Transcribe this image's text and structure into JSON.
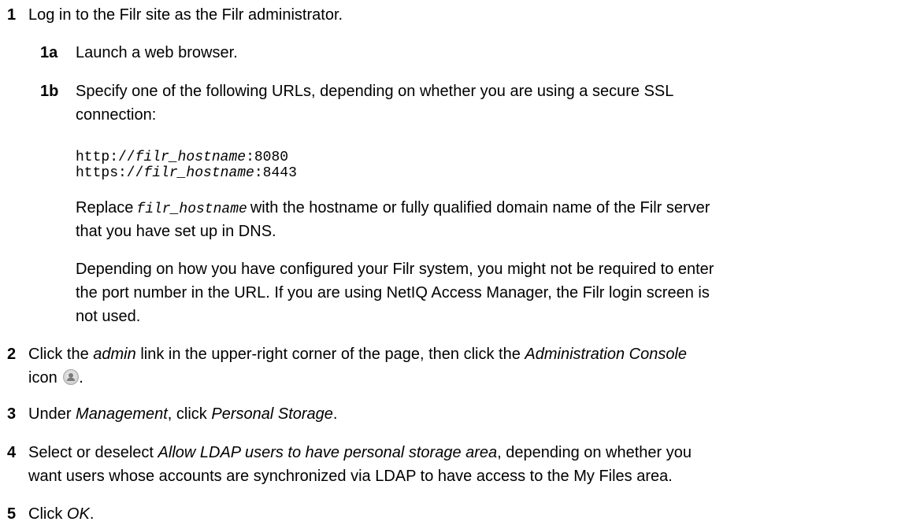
{
  "steps": [
    {
      "num": "1",
      "text": "Log in to the Filr site as the Filr administrator.",
      "substeps": [
        {
          "num": "1a",
          "text": "Launch a web browser."
        },
        {
          "num": "1b",
          "text_line1": "Specify one of the following URLs, depending on whether you are using a secure SSL",
          "text_line2": "connection:",
          "urls": [
            {
              "prefix": "http://",
              "var": "filr_hostname",
              "suffix": ":8080"
            },
            {
              "prefix": "https://",
              "var": "filr_hostname",
              "suffix": ":8443"
            }
          ],
          "replace": {
            "pre": "Replace",
            "var": "filr_hostname",
            "line1_rest": "with the hostname or fully qualified domain name of the Filr server",
            "line2": "that you have set up in DNS."
          },
          "note": {
            "line1": "Depending on how you have configured your Filr system, you might not be required to enter",
            "line2": "the port number in the URL. If you are using NetIQ Access Manager, the Filr login screen is",
            "line3": "not used."
          }
        }
      ]
    },
    {
      "num": "2",
      "pre": "Click the",
      "em1": "admin",
      "mid": "link in the upper-right corner of the page, then click the",
      "em2": "Administration Console",
      "line2": "icon",
      "icon": "administration-console-icon"
    },
    {
      "num": "3",
      "pre": "Under",
      "em1": "Management",
      "mid": ", click",
      "em2": "Personal Storage",
      "post": "."
    },
    {
      "num": "4",
      "pre": "Select or deselect",
      "em1": "Allow LDAP users to have personal storage area",
      "post": ", depending on whether you",
      "line2": "want users whose accounts are synchronized via LDAP to have access to the My Files area."
    },
    {
      "num": "5",
      "pre": "Click",
      "em1": "OK",
      "post": "."
    }
  ]
}
